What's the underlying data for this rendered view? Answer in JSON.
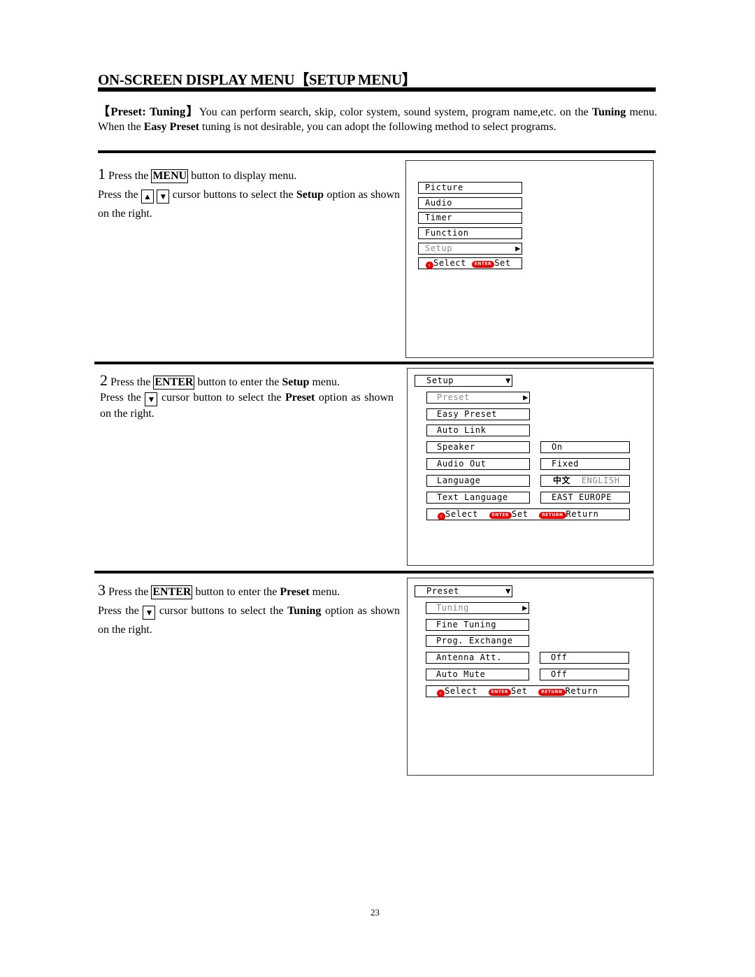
{
  "title": "ON-SCREEN DISPLAY MENU【SETUP MENU】",
  "intro": {
    "lead": "【Preset: Tuning】",
    "text1": "You can perform search, skip, color system, sound system, program name,etc. on the ",
    "bold1": "Tuning",
    "text2": " menu. When the ",
    "bold2": "Easy Preset",
    "text3": " tuning is not desirable, you can adopt the following method to select programs."
  },
  "icons": {
    "up": "▲",
    "down": "▼",
    "right": "▶",
    "updown": "⇕"
  },
  "steps": [
    {
      "num": "1",
      "a1": " Press the ",
      "key": "MENU",
      "a2": " button to display menu.",
      "b1": "Press the ",
      "b2": " cursor buttons to select the ",
      "bold": "Setup",
      "b3": " option as shown on the right."
    },
    {
      "num": "2",
      "a1": " Press the ",
      "key": "ENTER",
      "a2": " button to enter the ",
      "abold": "Setup",
      "a3": " menu.",
      "b1": "Press the ",
      "b2": " cursor button to select the ",
      "bold": "Preset",
      "b3": " option as shown on the right."
    },
    {
      "num": "3",
      "a1": " Press the ",
      "key": "ENTER",
      "a2": " button to enter the ",
      "abold": "Preset",
      "a3": " menu.",
      "b1": "Press the ",
      "b2": " cursor buttons to select the ",
      "bold": "Tuning",
      "b3": " option as shown on the right."
    }
  ],
  "osd1": {
    "items": [
      "Picture",
      "Audio",
      "Timer",
      "Function",
      "Setup"
    ],
    "selected": "Setup",
    "footer": {
      "select": "Select",
      "enter": "ENTER",
      "set": "Set"
    }
  },
  "osd2": {
    "header": "Setup",
    "items": [
      "Preset",
      "Easy Preset",
      "Auto Link",
      "Speaker",
      "Audio Out",
      "Language",
      "Text Language"
    ],
    "selected": "Preset",
    "values": {
      "speaker": "On",
      "audio_out": "Fixed",
      "language_cn": "中文",
      "language_en": "ENGLISH",
      "text_language": "EAST EUROPE"
    },
    "footer": {
      "select": "Select",
      "enter": "ENTER",
      "set": "Set",
      "return_pill": "RETURN",
      "return": "Return"
    }
  },
  "osd3": {
    "header": "Preset",
    "items": [
      "Tuning",
      "Fine Tuning",
      "Prog. Exchange",
      "Antenna Att.",
      "Auto Mute"
    ],
    "selected": "Tuning",
    "values": {
      "antenna_att": "Off",
      "auto_mute": "Off"
    },
    "footer": {
      "select": "Select",
      "enter": "ENTER",
      "set": "Set",
      "return_pill": "RETURN",
      "return": "Return"
    }
  },
  "page_number": "23"
}
